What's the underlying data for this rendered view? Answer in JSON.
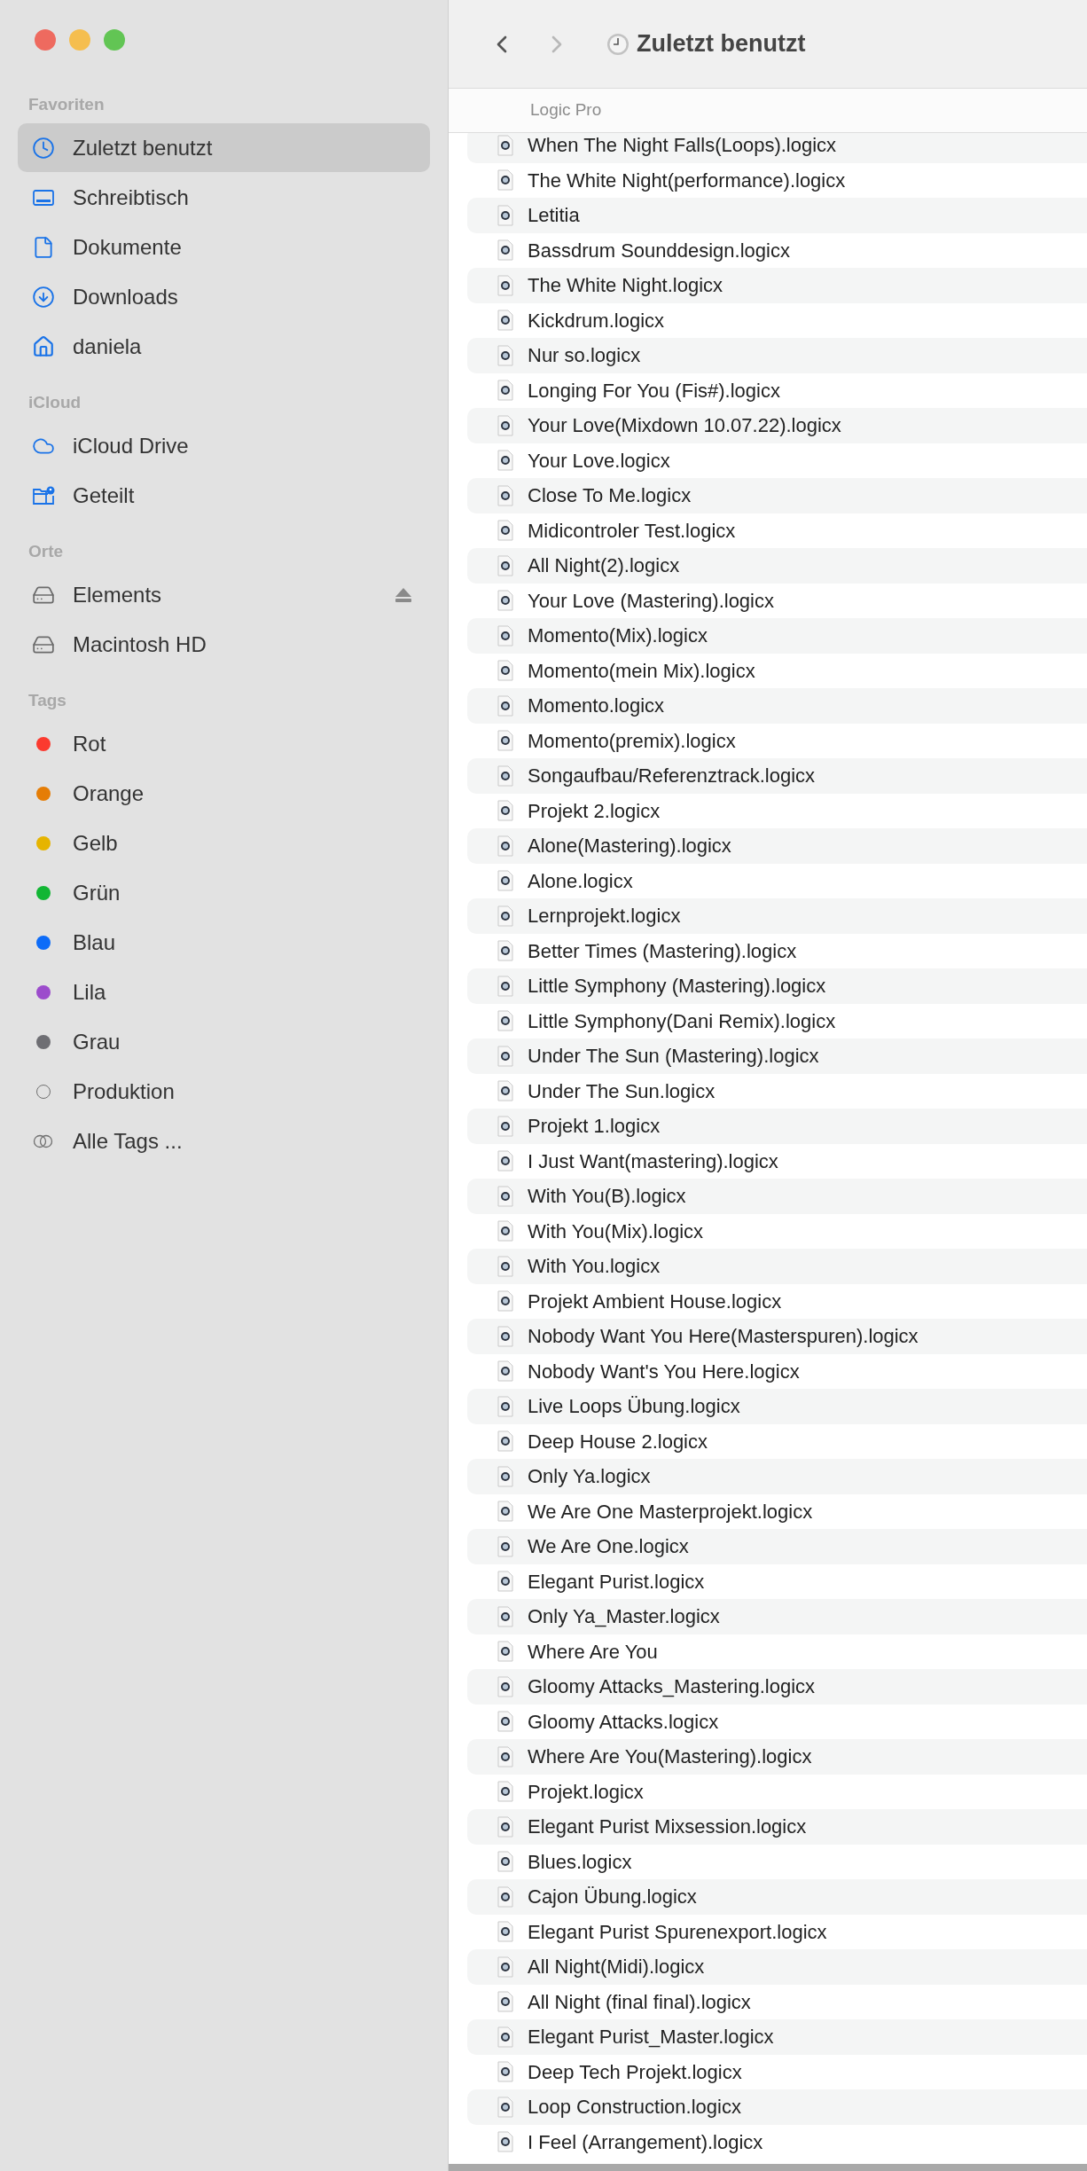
{
  "window": {
    "controls": [
      {
        "color": "#ee6a5f"
      },
      {
        "color": "#f5be4f"
      },
      {
        "color": "#62c554"
      }
    ]
  },
  "sidebar": {
    "sections": [
      {
        "title": "Favoriten",
        "items": [
          {
            "label": "Zuletzt benutzt",
            "kind": "recents",
            "selected": true
          },
          {
            "label": "Schreibtisch",
            "kind": "desktop",
            "selected": false
          },
          {
            "label": "Dokumente",
            "kind": "documents",
            "selected": false
          },
          {
            "label": "Downloads",
            "kind": "downloads",
            "selected": false
          },
          {
            "label": "daniela",
            "kind": "home",
            "selected": false
          }
        ]
      },
      {
        "title": "iCloud",
        "items": [
          {
            "label": "iCloud Drive",
            "kind": "cloud",
            "selected": false
          },
          {
            "label": "Geteilt",
            "kind": "shared",
            "selected": false
          }
        ]
      },
      {
        "title": "Orte",
        "items": [
          {
            "label": "Elements",
            "kind": "drive",
            "ejectable": true,
            "selected": false
          },
          {
            "label": "Macintosh HD",
            "kind": "disk",
            "ejectable": false,
            "selected": false
          }
        ]
      },
      {
        "title": "Tags",
        "items": [
          {
            "label": "Rot",
            "kind": "tag",
            "color": "#fb3a2f",
            "selected": false
          },
          {
            "label": "Orange",
            "kind": "tag",
            "color": "#e57d06",
            "selected": false
          },
          {
            "label": "Gelb",
            "kind": "tag",
            "color": "#e6b400",
            "selected": false
          },
          {
            "label": "Grün",
            "kind": "tag",
            "color": "#12b634",
            "selected": false
          },
          {
            "label": "Blau",
            "kind": "tag",
            "color": "#0d6cf8",
            "selected": false
          },
          {
            "label": "Lila",
            "kind": "tag",
            "color": "#9c4ccc",
            "selected": false
          },
          {
            "label": "Grau",
            "kind": "tag",
            "color": "#6e6e73",
            "selected": false
          },
          {
            "label": "Produktion",
            "kind": "empty_tag",
            "selected": false
          },
          {
            "label": "Alle Tags ...",
            "kind": "all_tags",
            "selected": false
          }
        ]
      }
    ]
  },
  "toolbar": {
    "back": {
      "disabled": false
    },
    "forward": {
      "disabled": true
    },
    "title": "Zuletzt benutzt"
  },
  "group": {
    "title": "Logic Pro",
    "files": [
      "When The Night Falls(Loops).logicx",
      "The White Night(performance).logicx",
      "Letitia",
      "Bassdrum Sounddesign.logicx",
      "The White Night.logicx",
      "Kickdrum.logicx",
      "Nur so.logicx",
      "Longing For You (Fis#).logicx",
      "Your Love(Mixdown 10.07.22).logicx",
      "Your Love.logicx",
      "Close To Me.logicx",
      "Midicontroler Test.logicx",
      "All Night(2).logicx",
      "Your Love (Mastering).logicx",
      "Momento(Mix).logicx",
      "Momento(mein Mix).logicx",
      "Momento.logicx",
      "Momento(premix).logicx",
      "Songaufbau/Referenztrack.logicx",
      "Projekt 2.logicx",
      "Alone(Mastering).logicx",
      "Alone.logicx",
      "Lernprojekt.logicx",
      "Better Times (Mastering).logicx",
      "Little Symphony (Mastering).logicx",
      "Little Symphony(Dani Remix).logicx",
      "Under The Sun (Mastering).logicx",
      "Under The Sun.logicx",
      "Projekt 1.logicx",
      "I Just Want(mastering).logicx",
      "With You(B).logicx",
      "With You(Mix).logicx",
      "With You.logicx",
      "Projekt Ambient House.logicx",
      "Nobody Want You Here(Masterspuren).logicx",
      "Nobody Want's You Here.logicx",
      "Live Loops Übung.logicx",
      "Deep House 2.logicx",
      "Only Ya.logicx",
      "We Are One Masterprojekt.logicx",
      "We Are One.logicx",
      "Elegant Purist.logicx",
      "Only Ya_Master.logicx",
      "Where Are You",
      "Gloomy Attacks_Mastering.logicx",
      "Gloomy Attacks.logicx",
      "Where Are You(Mastering).logicx",
      "Projekt.logicx",
      "Elegant Purist Mixsession.logicx",
      "Blues.logicx",
      "Cajon Übung.logicx",
      "Elegant Purist Spurenexport.logicx",
      "All Night(Midi).logicx",
      "All Night (final final).logicx",
      "Elegant Purist_Master.logicx",
      "Deep Tech Projekt.logicx",
      "Loop Construction.logicx",
      "I Feel (Arrangement).logicx"
    ]
  }
}
